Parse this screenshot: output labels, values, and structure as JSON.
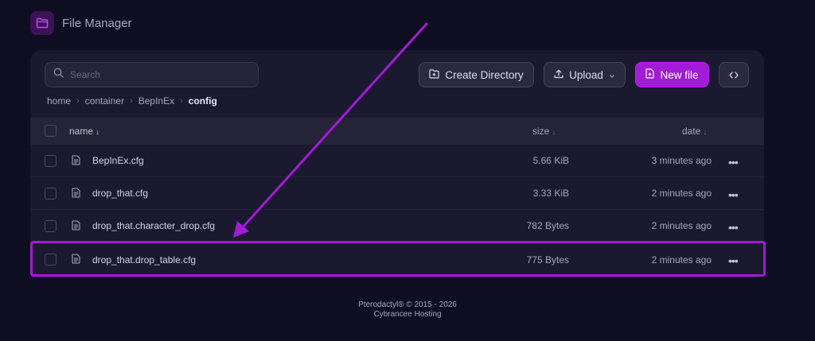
{
  "app": {
    "title": "File Manager",
    "logo_icon": "folder-icon"
  },
  "search": {
    "placeholder": "Search",
    "value": ""
  },
  "toolbar": {
    "create_directory_label": "Create Directory",
    "upload_label": "Upload",
    "new_file_label": "New file",
    "code_label": "<>",
    "accent_color": "#a21bd6"
  },
  "breadcrumb": {
    "items": [
      "home",
      "container",
      "BepInEx"
    ],
    "current": "config"
  },
  "table": {
    "columns": {
      "name": "name",
      "size": "size",
      "date": "date"
    },
    "rows": [
      {
        "name": "BepInEx.cfg",
        "size": "5.66 KiB",
        "date": "3 minutes ago"
      },
      {
        "name": "drop_that.cfg",
        "size": "3.33 KiB",
        "date": "2 minutes ago"
      },
      {
        "name": "drop_that.character_drop.cfg",
        "size": "782 Bytes",
        "date": "2 minutes ago"
      },
      {
        "name": "drop_that.drop_table.cfg",
        "size": "775 Bytes",
        "date": "2 minutes ago"
      }
    ]
  },
  "annotation": {
    "highlighted_row": "drop_that.drop_table.cfg",
    "color": "#a21bd6"
  },
  "footer": {
    "line1": "Pterodactyl® © 2015 - 2026",
    "line2": "Cybrancee Hosting"
  }
}
